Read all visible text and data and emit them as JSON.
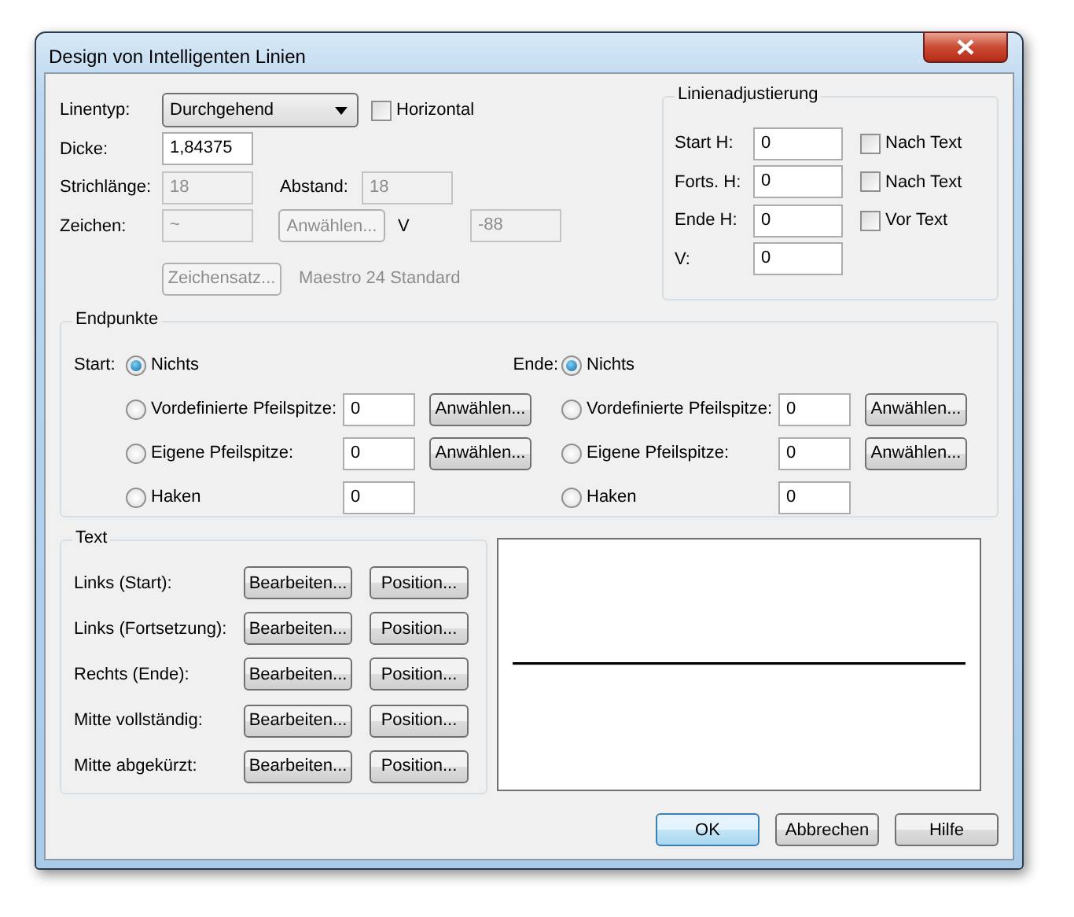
{
  "window": {
    "title": "Design von Intelligenten Linien"
  },
  "line": {
    "line_type": {
      "label": "Linentyp:",
      "value": "Durchgehend"
    },
    "horizontal": {
      "label": "Horizontal",
      "checked": false
    },
    "thickness": {
      "label": "Dicke:",
      "value": "1,84375",
      "disabled": false
    },
    "dash_length": {
      "label": "Strichlänge:",
      "value": "18",
      "disabled": true
    },
    "spacing": {
      "label": "Abstand:",
      "value": "18",
      "disabled": true
    },
    "symbol": {
      "label": "Zeichen:",
      "value": "~",
      "disabled": true
    },
    "select_button": {
      "label": "Anwählen...",
      "disabled": true
    },
    "v": {
      "label": "V",
      "value": "-88",
      "disabled": true
    },
    "font_button": {
      "label": "Zeichensatz...",
      "disabled": true
    },
    "font_name": "Maestro 24 Standard"
  },
  "adjust": {
    "title": "Linienadjustierung",
    "rows": [
      {
        "label": "Start H:",
        "value": "0",
        "checkbox": {
          "label": "Nach Text",
          "checked": false
        }
      },
      {
        "label": "Forts. H:",
        "value": "0",
        "checkbox": {
          "label": "Nach Text",
          "checked": false
        }
      },
      {
        "label": "Ende H:",
        "value": "0",
        "checkbox": {
          "label": "Vor Text",
          "checked": false
        }
      },
      {
        "label": "V:",
        "value": "0"
      }
    ]
  },
  "endpoints": {
    "title": "Endpunkte",
    "sides": [
      {
        "label": "Start:",
        "options": [
          {
            "kind": "plain",
            "label": "Nichts",
            "selected": true
          },
          {
            "kind": "field_button",
            "label": "Vordefinierte Pfeilspitze:",
            "value": "0",
            "button": "Anwählen...",
            "selected": false
          },
          {
            "kind": "field_button",
            "label": "Eigene Pfeilspitze:",
            "value": "0",
            "button": "Anwählen...",
            "selected": false
          },
          {
            "kind": "field",
            "label": "Haken",
            "value": "0",
            "selected": false
          }
        ]
      },
      {
        "label": "Ende:",
        "options": [
          {
            "kind": "plain",
            "label": "Nichts",
            "selected": true
          },
          {
            "kind": "field_button",
            "label": "Vordefinierte Pfeilspitze:",
            "value": "0",
            "button": "Anwählen...",
            "selected": false
          },
          {
            "kind": "field_button",
            "label": "Eigene Pfeilspitze:",
            "value": "0",
            "button": "Anwählen...",
            "selected": false
          },
          {
            "kind": "field",
            "label": "Haken",
            "value": "0",
            "selected": false
          }
        ]
      }
    ]
  },
  "text": {
    "title": "Text",
    "rows": [
      {
        "label": "Links (Start):",
        "edit": "Bearbeiten...",
        "position": "Position..."
      },
      {
        "label": "Links (Fortsetzung):",
        "edit": "Bearbeiten...",
        "position": "Position..."
      },
      {
        "label": "Rechts (Ende):",
        "edit": "Bearbeiten...",
        "position": "Position..."
      },
      {
        "label": "Mitte vollständig:",
        "edit": "Bearbeiten...",
        "position": "Position..."
      },
      {
        "label": "Mitte abgekürzt:",
        "edit": "Bearbeiten...",
        "position": "Position..."
      }
    ]
  },
  "buttons": [
    {
      "label": "OK",
      "default": true
    },
    {
      "label": "Abbrechen",
      "default": false
    },
    {
      "label": "Hilfe",
      "default": false
    }
  ]
}
